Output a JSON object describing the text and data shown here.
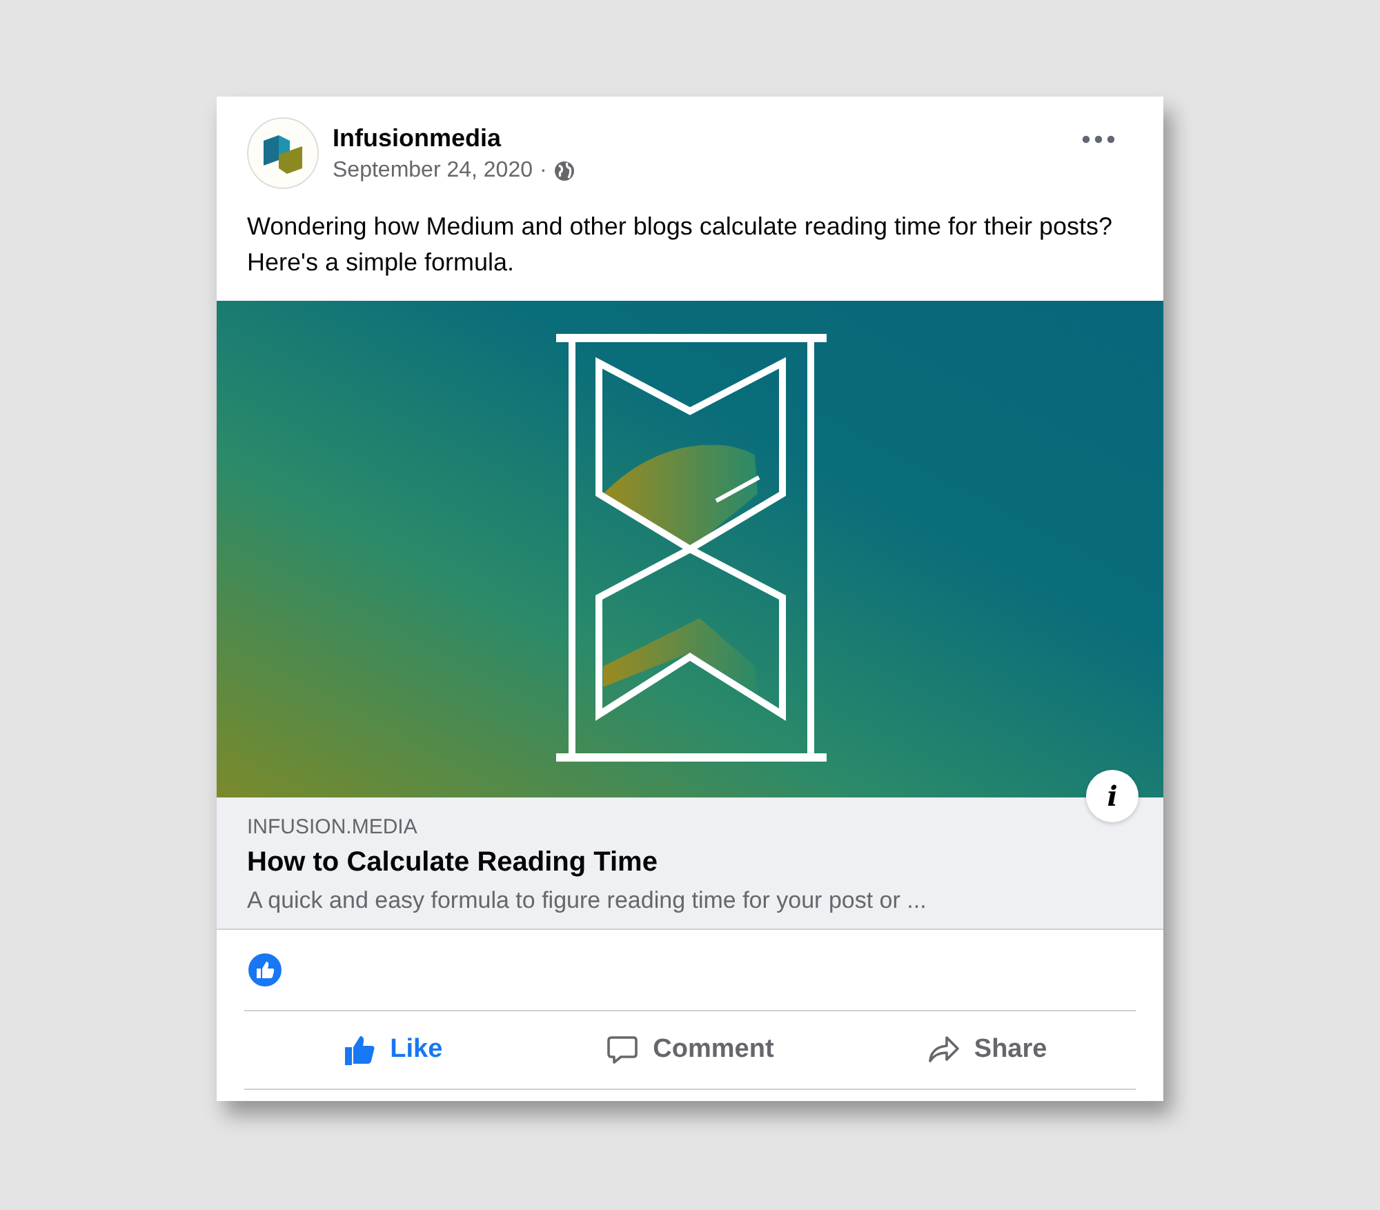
{
  "post": {
    "author": "Infusionmedia",
    "date": "September 24, 2020",
    "separator": "·",
    "text": "Wondering how Medium and other blogs calculate reading time for their posts? Here's a simple formula."
  },
  "link_preview": {
    "domain": "INFUSION.MEDIA",
    "title": "How to Calculate Reading Time",
    "description": "A quick and easy formula to figure reading time for your post or ...",
    "info": "i"
  },
  "actions": [
    {
      "kind": "like",
      "label": "Like",
      "selected": true
    },
    {
      "kind": "comment",
      "label": "Comment",
      "selected": false
    },
    {
      "kind": "share",
      "label": "Share",
      "selected": false
    }
  ]
}
